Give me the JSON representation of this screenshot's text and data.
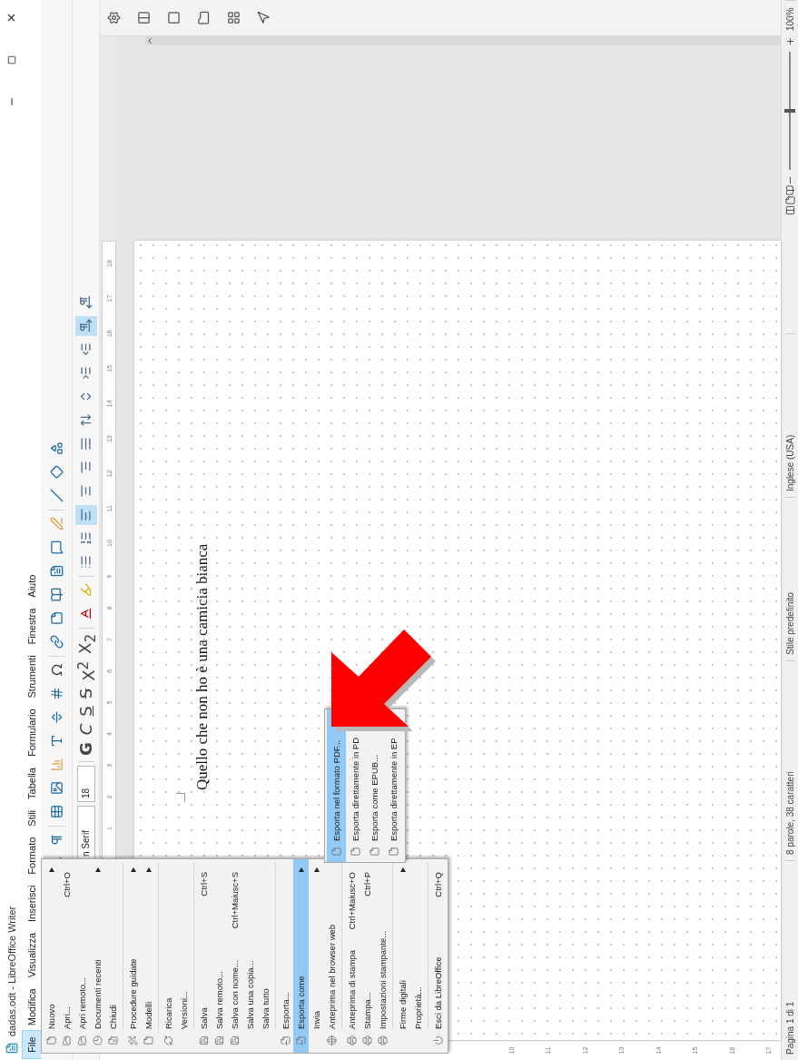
{
  "window": {
    "title": "dadas.odt - LibreOffice Writer"
  },
  "menu_bar": [
    {
      "label": "File",
      "selected": true
    },
    {
      "label": "Modifica",
      "selected": false
    },
    {
      "label": "Visualizza",
      "selected": false
    },
    {
      "label": "Inserisci",
      "selected": false
    },
    {
      "label": "Formato",
      "selected": false
    },
    {
      "label": "Stili",
      "selected": false
    },
    {
      "label": "Tabella",
      "selected": false
    },
    {
      "label": "Formulario",
      "selected": false
    },
    {
      "label": "Strumenti",
      "selected": false
    },
    {
      "label": "Finestra",
      "selected": false
    },
    {
      "label": "Aiuto",
      "selected": false
    }
  ],
  "formatting_toolbar": {
    "font_name": "n Serif",
    "font_size": "18",
    "text_buttons": [
      {
        "label": "G",
        "kind": "bold"
      },
      {
        "label": "C",
        "kind": "italic"
      },
      {
        "label": "S",
        "kind": "underline"
      },
      {
        "label": "S",
        "kind": "strike"
      },
      {
        "label": "X$^{2}$",
        "kind": "plain"
      },
      {
        "label": "X$_{2}$",
        "kind": "plain"
      }
    ],
    "paragraph_buttons": [
      {
        "selected": false
      },
      {
        "selected": false
      },
      {
        "selected": true
      },
      {
        "selected": false
      },
      {
        "selected": false
      },
      {
        "selected": false
      },
      {
        "selected": false
      },
      {
        "selected": false
      },
      {
        "selected": false
      },
      {
        "selected": false
      },
      {
        "selected": true
      },
      {
        "selected": false
      }
    ]
  },
  "ruler": {
    "marks": [
      "1",
      "2",
      "3",
      "4",
      "5",
      "6",
      "7",
      "8",
      "9",
      "10",
      "11",
      "12",
      "13",
      "14",
      "15",
      "16",
      "17",
      "18"
    ]
  },
  "vertical_ruler": {
    "marks": [
      "10",
      "11",
      "12",
      "13",
      "14",
      "15",
      "16",
      "17"
    ]
  },
  "document": {
    "text": "Quello che non ho è una camicia bianca"
  },
  "file_menu": [
    {
      "kind": "item",
      "label": "Nuovo",
      "has_submenu": true,
      "selected": false
    },
    {
      "kind": "item",
      "label": "Apri...",
      "shortcut": "Ctrl+O",
      "selected": false
    },
    {
      "kind": "item",
      "label": "Apri remoto...",
      "selected": false
    },
    {
      "kind": "item",
      "label": "Documenti recenti",
      "has_submenu": true,
      "selected": false
    },
    {
      "kind": "item",
      "label": "Chiudi",
      "selected": false
    },
    {
      "kind": "separator"
    },
    {
      "kind": "item",
      "label": "Procedure guidate",
      "has_submenu": true,
      "selected": false
    },
    {
      "kind": "item",
      "label": "Modelli",
      "has_submenu": true,
      "selected": false
    },
    {
      "kind": "separator"
    },
    {
      "kind": "item",
      "label": "Ricarica",
      "selected": false
    },
    {
      "kind": "item",
      "label": "Versioni...",
      "selected": false
    },
    {
      "kind": "separator"
    },
    {
      "kind": "item",
      "label": "Salva",
      "shortcut": "Ctrl+S",
      "selected": false
    },
    {
      "kind": "item",
      "label": "Salva remoto...",
      "selected": false
    },
    {
      "kind": "item",
      "label": "Salva con nome...",
      "shortcut": "Ctrl+Maiusc+S",
      "selected": false
    },
    {
      "kind": "item",
      "label": "Salva una copia...",
      "selected": false
    },
    {
      "kind": "item",
      "label": "Salva tutto",
      "selected": false
    },
    {
      "kind": "separator"
    },
    {
      "kind": "item",
      "label": "Esporta...",
      "selected": false
    },
    {
      "kind": "item",
      "label": "Esporta come",
      "has_submenu": true,
      "selected": true
    },
    {
      "kind": "item",
      "label": "Invia",
      "has_submenu": true,
      "selected": false
    },
    {
      "kind": "item",
      "label": "Anteprima nel browser web",
      "selected": false
    },
    {
      "kind": "separator"
    },
    {
      "kind": "item",
      "label": "Anteprima di stampa",
      "shortcut": "Ctrl+Maiusc+O",
      "selected": false
    },
    {
      "kind": "item",
      "label": "Stampa...",
      "shortcut": "Ctrl+P",
      "selected": false
    },
    {
      "kind": "item",
      "label": "Impostazioni stampante...",
      "selected": false
    },
    {
      "kind": "separator"
    },
    {
      "kind": "item",
      "label": "Firme digitali",
      "has_submenu": true,
      "selected": false
    },
    {
      "kind": "item",
      "label": "Proprietà...",
      "selected": false
    },
    {
      "kind": "separator"
    },
    {
      "kind": "item",
      "label": "Esci da LibreOffice",
      "shortcut": "Ctrl+Q",
      "selected": false
    }
  ],
  "export_submenu": [
    {
      "label": "Esporta nel formato PDF...",
      "selected": true
    },
    {
      "label": "Esporta direttamente in PD",
      "selected": false
    },
    {
      "label": "Esporta come EPUB...",
      "selected": false
    },
    {
      "label": "Esporta direttamente in EP",
      "selected": false
    }
  ],
  "status_bar": {
    "page": "Pagina 1 di 1",
    "words": "8 parole, 38 caratteri",
    "style": "Stile predefinito",
    "language": "Inglese (USA)",
    "zoom": {
      "level": 0.5,
      "reading": "100%"
    }
  }
}
